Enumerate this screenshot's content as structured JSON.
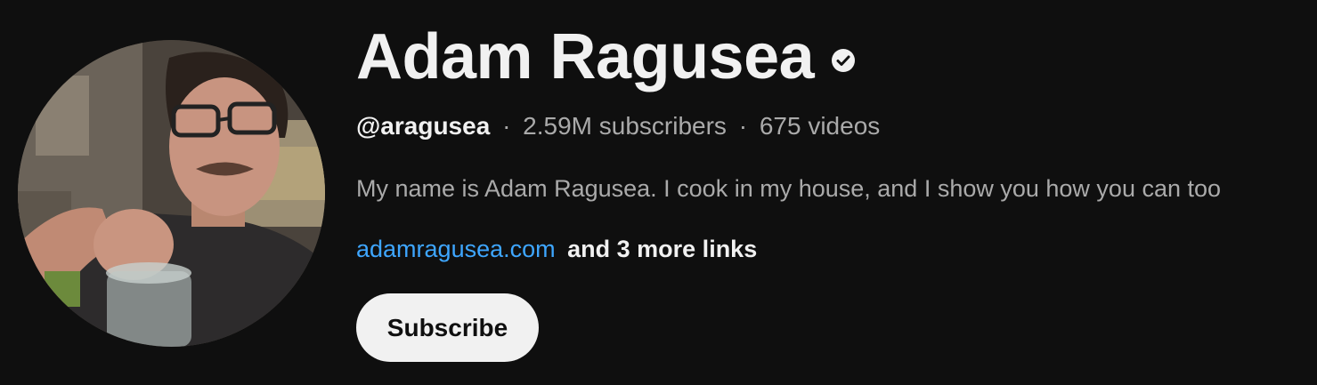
{
  "channel": {
    "name": "Adam Ragusea",
    "verified_icon": "verified-check-icon",
    "handle": "@aragusea",
    "subscribers": "2.59M subscribers",
    "videos": "675 videos",
    "separator": "·",
    "description": "My name is Adam Ragusea. I cook in my house, and I show you how you can too",
    "link_text": "adamragusea.com",
    "more_links": "and 3 more links",
    "subscribe_label": "Subscribe"
  },
  "colors": {
    "background": "#0f0f0f",
    "link": "#3ea6ff",
    "primary_text": "#f1f1f1",
    "secondary_text": "#aaaaaa",
    "button_bg": "#f1f1f1"
  }
}
